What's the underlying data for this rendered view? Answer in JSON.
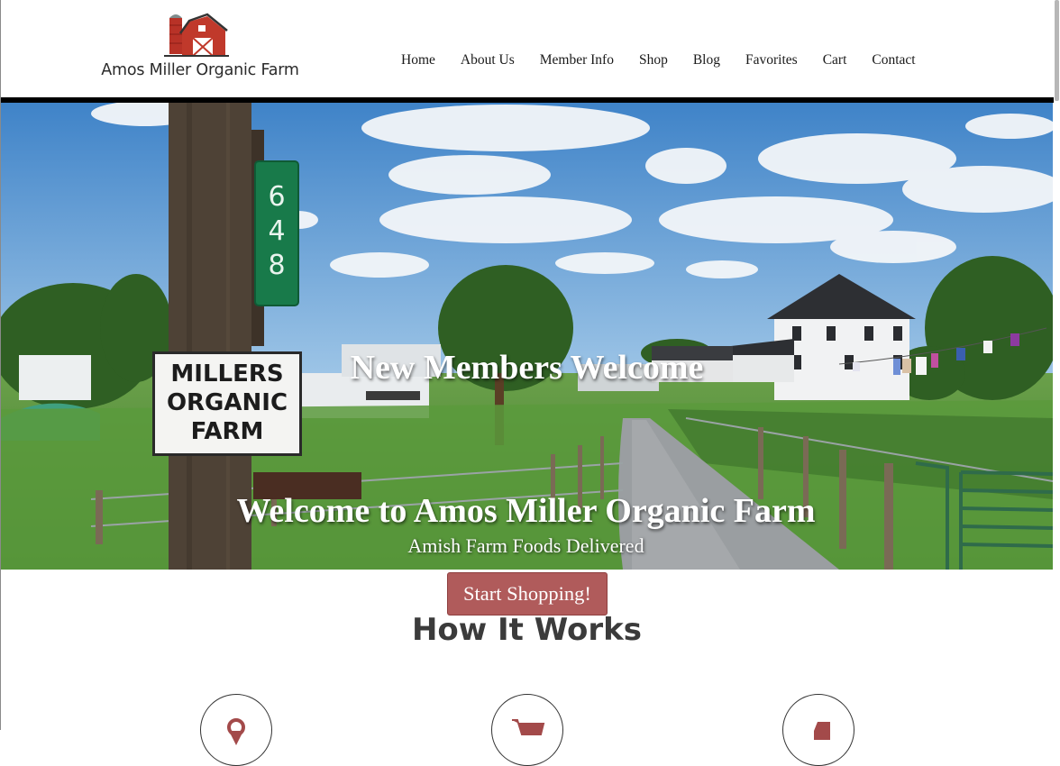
{
  "header": {
    "logo_text": "Amos Miller Organic Farm",
    "nav": [
      "Home",
      "About Us",
      "Member Info",
      "Shop",
      "Blog",
      "Favorites",
      "Cart",
      "Contact"
    ]
  },
  "hero": {
    "overlay_title": "New Members Welcome",
    "heading": "Welcome to Amos Miller Organic Farm",
    "subheading": "Amish Farm Foods Delivered",
    "sign_text": [
      "MILLERS",
      "ORGANIC",
      "FARM"
    ],
    "address_number": [
      "6",
      "4",
      "8"
    ]
  },
  "cta": {
    "label": "Start Shopping!"
  },
  "how_it_works": {
    "title": "How It Works",
    "steps": [
      {
        "icon": "map-pin-icon"
      },
      {
        "icon": "shopping-cart-icon"
      },
      {
        "icon": "delivery-truck-icon"
      }
    ]
  },
  "colors": {
    "accent": "#b05b5b",
    "header_rule": "#000000",
    "logo_barn": "#c0392b"
  }
}
